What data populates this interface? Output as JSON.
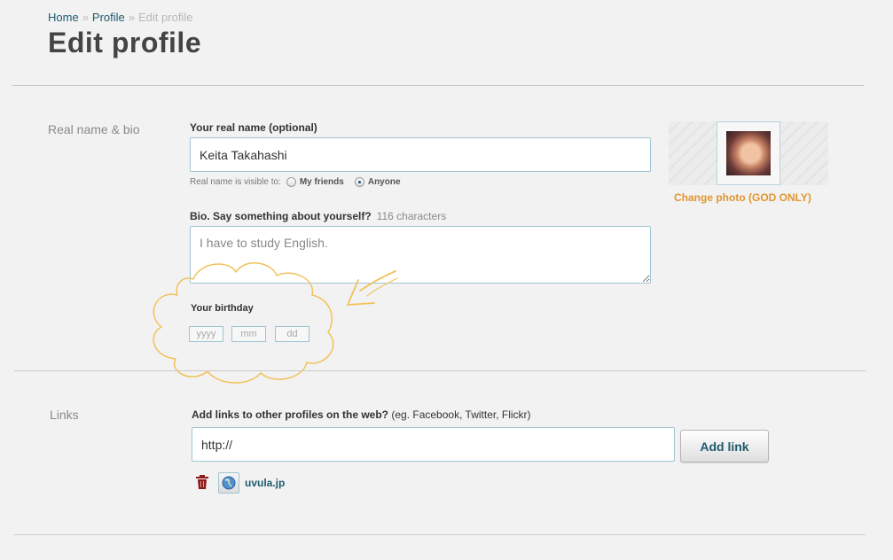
{
  "breadcrumb": {
    "home": "Home",
    "separator": "»",
    "profile": "Profile",
    "current": "Edit profile"
  },
  "page_title": "Edit profile",
  "sections": {
    "realname": {
      "label": "Real name & bio",
      "name_label": "Your real name (optional)",
      "name_value": "Keita Takahashi",
      "visible_to_label": "Real name is visible to:",
      "visibility_options": [
        "My friends",
        "Anyone"
      ],
      "visibility_selected": "Anyone",
      "bio_label": "Bio. Say something about yourself?",
      "bio_char_count": "116 characters",
      "bio_value": "I have to study English.",
      "birthday_label": "Your birthday",
      "birthday_placeholders": {
        "year": "yyyy",
        "month": "mm",
        "day": "dd"
      },
      "change_photo": "Change photo (GOD ONLY)"
    },
    "links": {
      "label": "Links",
      "add_label_bold": "Add links to other profiles on the web?",
      "add_label_hint": "(eg. Facebook, Twitter, Flickr)",
      "url_value": "http://",
      "add_button": "Add link",
      "items": [
        {
          "text": "uvula.jp"
        }
      ]
    }
  },
  "colors": {
    "accent_link": "#1f5a6e",
    "accent_orange": "#e2952f",
    "input_border": "#9fc4d2",
    "trash": "#8b1a1a"
  },
  "icons": {
    "trash": "trash-icon",
    "globe": "globe-icon",
    "cloud": "cloud-doodle",
    "arrow": "arrow-doodle"
  }
}
